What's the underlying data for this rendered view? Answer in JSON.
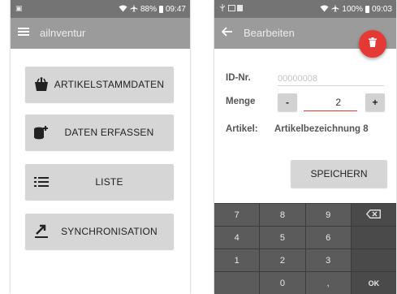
{
  "left_screen": {
    "status_left": "▣",
    "status_right": "88%",
    "time": "09:47",
    "title": "ailnventur",
    "menu": [
      {
        "label": "ARTIKELSTAMMDATEN",
        "icon": "scale-icon"
      },
      {
        "label": "DATEN ERFASSEN",
        "icon": "database-plus-icon"
      },
      {
        "label": "LISTE",
        "icon": "list-icon"
      },
      {
        "label": "SYNCHRONISATION",
        "icon": "sync-upload-icon"
      }
    ]
  },
  "right_screen": {
    "status_right": "100%",
    "time": "09:03",
    "title": "Bearbeiten",
    "id_label": "ID-Nr.",
    "id_value": "00000008",
    "menge_label": "Menge",
    "minus_label": "-",
    "plus_label": "+",
    "menge_value": "2",
    "artikel_label": "Artikel:",
    "artikel_value": "Artikelbezeichnung 8",
    "save_label": "SPEICHERN",
    "keypad": [
      "7",
      "8",
      "9",
      "⌫",
      "4",
      "5",
      "6",
      "",
      "1",
      "2",
      "3",
      "",
      "",
      "0",
      ",",
      "OK"
    ]
  },
  "colors": {
    "appbar": "#9b9b9b",
    "statusbar": "#747474",
    "accent": "#e53935",
    "button": "#d6d6d6",
    "keypad": "#5b5b5b"
  }
}
